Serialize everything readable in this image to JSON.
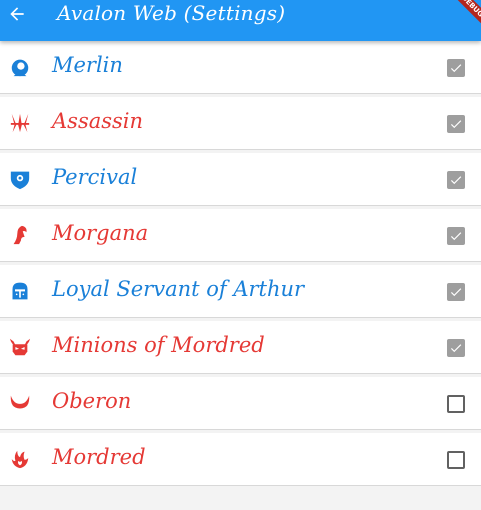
{
  "app_bar": {
    "title": "Avalon Web (Settings)",
    "debug_banner": "DEBUG",
    "background_color": "#2196f3"
  },
  "colors": {
    "good": "#1a80d8",
    "evil": "#e53935",
    "checkbox_on": "#9e9e9e"
  },
  "characters": [
    {
      "name": "Merlin",
      "team": "good",
      "icon": "wizard-icon",
      "selected": true
    },
    {
      "name": "Assassin",
      "team": "evil",
      "icon": "daggers-icon",
      "selected": true
    },
    {
      "name": "Percival",
      "team": "good",
      "icon": "shield-eye-icon",
      "selected": true
    },
    {
      "name": "Morgana",
      "team": "evil",
      "icon": "witch-icon",
      "selected": true
    },
    {
      "name": "Loyal Servant of Arthur",
      "team": "good",
      "icon": "knight-helmet-icon",
      "selected": true
    },
    {
      "name": "Minions of Mordred",
      "team": "evil",
      "icon": "horned-helmet-icon",
      "selected": true
    },
    {
      "name": "Oberon",
      "team": "evil",
      "icon": "horns-icon",
      "selected": false
    },
    {
      "name": "Mordred",
      "team": "evil",
      "icon": "dark-flame-icon",
      "selected": false
    }
  ]
}
